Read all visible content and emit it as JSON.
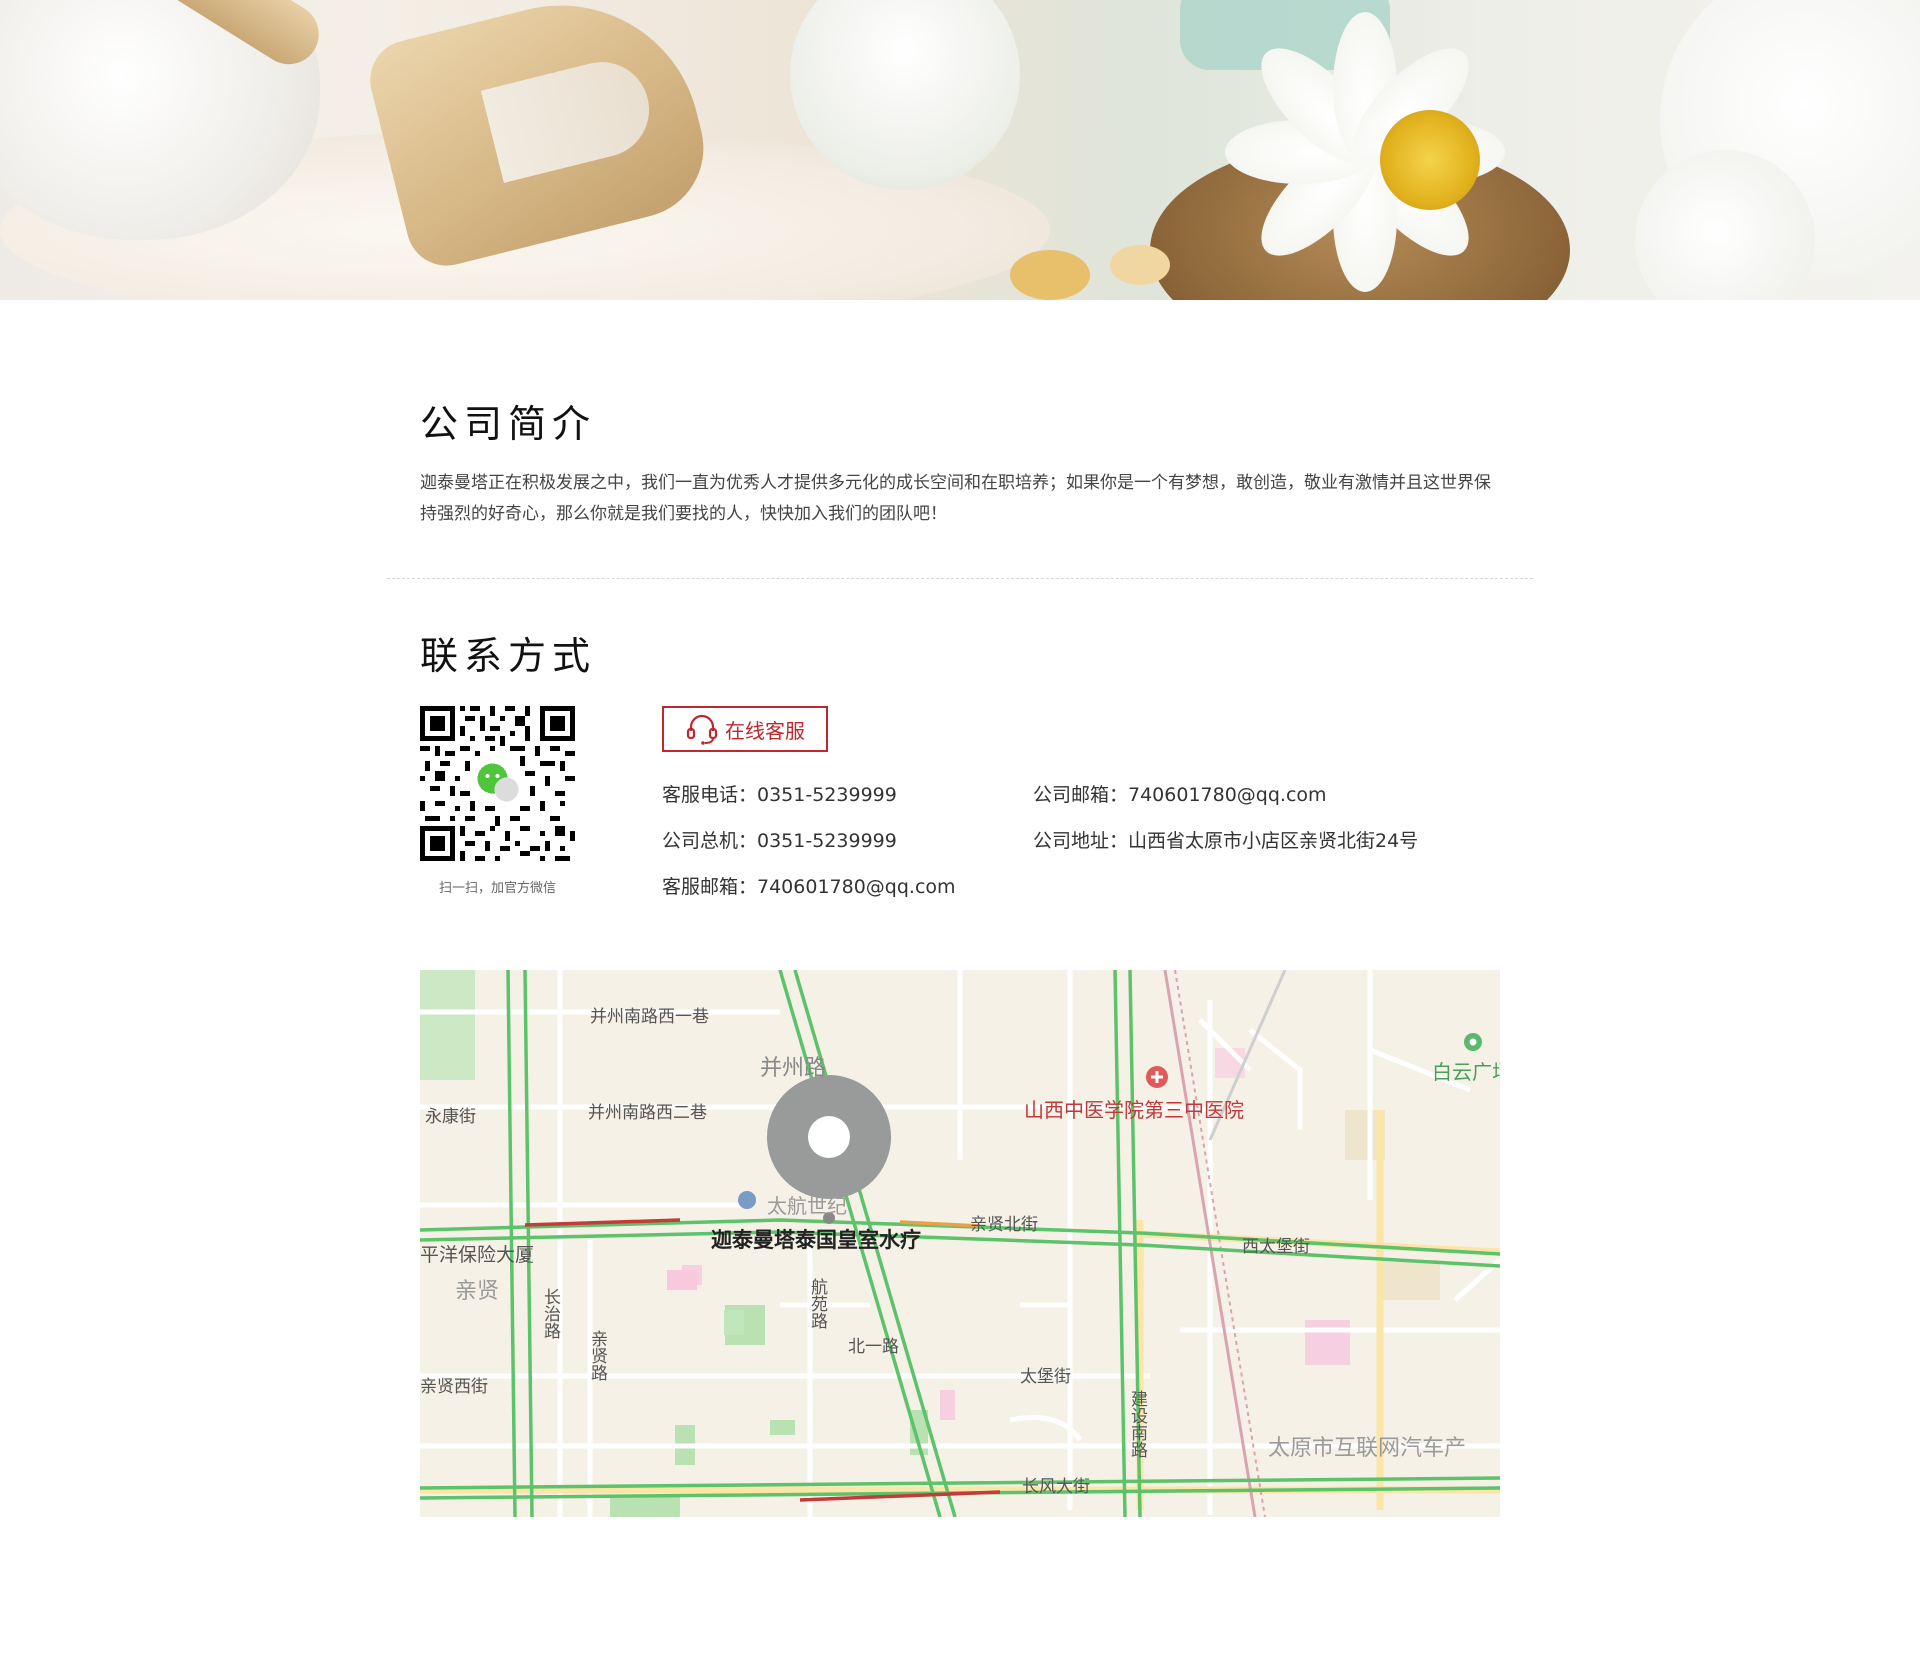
{
  "intro": {
    "title": "公司简介",
    "text": "迦泰曼塔正在积极发展之中，我们一直为优秀人才提供多元化的成长空间和在职培养；如果你是一个有梦想，敢创造，敬业有激情并且这世界保持强烈的好奇心，那么你就是我们要找的人，快快加入我们的团队吧！"
  },
  "contact": {
    "title": "联系方式",
    "qr_caption": "扫一扫，加官方微信",
    "online_service_label": "在线客服",
    "service_phone": "客服电话：0351-5239999",
    "switchboard": "公司总机：0351-5239999",
    "service_email": "客服邮箱：740601780@qq.com",
    "company_email": "公司邮箱：740601780@qq.com",
    "company_address": "公司地址：山西省太原市小店区亲贤北街24号"
  },
  "map": {
    "labels": {
      "bingzhou_west_1": "并州南路西一巷",
      "bingzhou_west_2": "并州南路西二巷",
      "bingzhou_road": "并州路",
      "yongkang": "永康街",
      "hospital": "山西中医学院第三中医院",
      "baiyun": "白云广场",
      "taihang": "太航世纪",
      "place": "迦泰曼塔泰国皇室水疗",
      "qinxian_north": "亲贤北街",
      "xitaibao": "西太堡街",
      "pingyang": "平洋保险大厦",
      "qinxian": "亲贤",
      "hangyuan": "航苑路",
      "beiyi": "北一路",
      "taibao": "太堡街",
      "jianshe_south": "建设南路",
      "qinxian_west": "亲贤西街",
      "qinxian_road": "亲贤路",
      "internet_car": "太原市互联网汽车产",
      "changfeng": "长风大街",
      "changzhi": "长治路"
    }
  },
  "colors": {
    "accent": "#c0272d",
    "road_green": "#5cc36a",
    "road_red": "#c43b3b",
    "road_orange": "#e8a04a",
    "map_bg": "#f6f1e6",
    "pin": "#999a9a"
  }
}
